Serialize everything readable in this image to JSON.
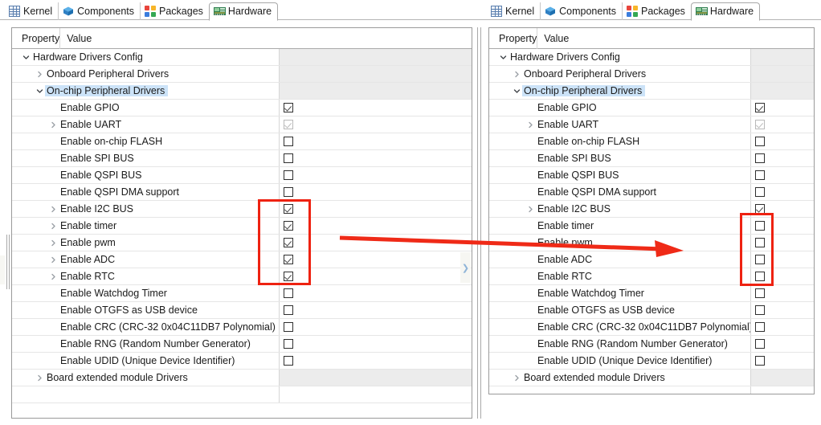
{
  "tabs": [
    {
      "id": "kernel",
      "label": "Kernel",
      "icon": "kernel-grid-icon",
      "active": false
    },
    {
      "id": "components",
      "label": "Components",
      "icon": "blue-cube-icon",
      "active": false
    },
    {
      "id": "packages",
      "label": "Packages",
      "icon": "packages-icon",
      "active": false
    },
    {
      "id": "hardware",
      "label": "Hardware",
      "icon": "board-chip-icon",
      "active": true
    }
  ],
  "columns": {
    "property": "Property",
    "value": "Value"
  },
  "colors": {
    "selection": "#cce3f8",
    "annotation": "#ee2211",
    "parent_row_value_bg": "#ececec",
    "grid_line": "#e6e6e6"
  },
  "before": {
    "rows": [
      {
        "label": "Hardware Drivers Config",
        "indent": 0,
        "twisty": "open",
        "value": "none",
        "selected": false
      },
      {
        "label": "Onboard Peripheral Drivers",
        "indent": 1,
        "twisty": "closed",
        "value": "none",
        "selected": false
      },
      {
        "label": "On-chip Peripheral Drivers",
        "indent": 1,
        "twisty": "open",
        "value": "none",
        "selected": true
      },
      {
        "label": "Enable GPIO",
        "indent": 2,
        "twisty": "none",
        "value": "checked",
        "selected": false
      },
      {
        "label": "Enable UART",
        "indent": 2,
        "twisty": "closed",
        "value": "checked-disabled",
        "selected": false
      },
      {
        "label": "Enable on-chip FLASH",
        "indent": 2,
        "twisty": "none",
        "value": "unchecked",
        "selected": false
      },
      {
        "label": "Enable SPI BUS",
        "indent": 2,
        "twisty": "none",
        "value": "unchecked",
        "selected": false
      },
      {
        "label": "Enable QSPI BUS",
        "indent": 2,
        "twisty": "none",
        "value": "unchecked",
        "selected": false
      },
      {
        "label": "Enable QSPI DMA support",
        "indent": 2,
        "twisty": "none",
        "value": "unchecked",
        "selected": false
      },
      {
        "label": "Enable I2C BUS",
        "indent": 2,
        "twisty": "closed",
        "value": "checked",
        "selected": false
      },
      {
        "label": "Enable timer",
        "indent": 2,
        "twisty": "closed",
        "value": "checked",
        "selected": false
      },
      {
        "label": "Enable pwm",
        "indent": 2,
        "twisty": "closed",
        "value": "checked",
        "selected": false
      },
      {
        "label": "Enable ADC",
        "indent": 2,
        "twisty": "closed",
        "value": "checked",
        "selected": false
      },
      {
        "label": "Enable RTC",
        "indent": 2,
        "twisty": "closed",
        "value": "checked",
        "selected": false
      },
      {
        "label": "Enable Watchdog Timer",
        "indent": 2,
        "twisty": "none",
        "value": "unchecked",
        "selected": false
      },
      {
        "label": "Enable OTGFS as USB device",
        "indent": 2,
        "twisty": "none",
        "value": "unchecked",
        "selected": false
      },
      {
        "label": "Enable CRC (CRC-32 0x04C11DB7 Polynomial)",
        "indent": 2,
        "twisty": "none",
        "value": "unchecked",
        "selected": false
      },
      {
        "label": "Enable RNG (Random Number Generator)",
        "indent": 2,
        "twisty": "none",
        "value": "unchecked",
        "selected": false
      },
      {
        "label": "Enable UDID (Unique Device Identifier)",
        "indent": 2,
        "twisty": "none",
        "value": "unchecked",
        "selected": false
      },
      {
        "label": "Board extended module Drivers",
        "indent": 1,
        "twisty": "closed",
        "value": "none",
        "selected": false
      },
      {
        "label": "",
        "indent": 0,
        "twisty": "none",
        "value": "blank",
        "selected": false
      }
    ]
  },
  "after": {
    "rows": [
      {
        "label": "Hardware Drivers Config",
        "indent": 0,
        "twisty": "open",
        "value": "none",
        "selected": false
      },
      {
        "label": "Onboard Peripheral Drivers",
        "indent": 1,
        "twisty": "closed",
        "value": "none",
        "selected": false
      },
      {
        "label": "On-chip Peripheral Drivers",
        "indent": 1,
        "twisty": "open",
        "value": "none",
        "selected": true
      },
      {
        "label": "Enable GPIO",
        "indent": 2,
        "twisty": "none",
        "value": "checked",
        "selected": false
      },
      {
        "label": "Enable UART",
        "indent": 2,
        "twisty": "closed",
        "value": "checked-disabled",
        "selected": false
      },
      {
        "label": "Enable on-chip FLASH",
        "indent": 2,
        "twisty": "none",
        "value": "unchecked",
        "selected": false
      },
      {
        "label": "Enable SPI BUS",
        "indent": 2,
        "twisty": "none",
        "value": "unchecked",
        "selected": false
      },
      {
        "label": "Enable QSPI BUS",
        "indent": 2,
        "twisty": "none",
        "value": "unchecked",
        "selected": false
      },
      {
        "label": "Enable QSPI DMA support",
        "indent": 2,
        "twisty": "none",
        "value": "unchecked",
        "selected": false
      },
      {
        "label": "Enable I2C BUS",
        "indent": 2,
        "twisty": "closed",
        "value": "checked",
        "selected": false
      },
      {
        "label": "Enable timer",
        "indent": 2,
        "twisty": "none",
        "value": "unchecked",
        "selected": false
      },
      {
        "label": "Enable pwm",
        "indent": 2,
        "twisty": "none",
        "value": "unchecked",
        "selected": false
      },
      {
        "label": "Enable ADC",
        "indent": 2,
        "twisty": "none",
        "value": "unchecked",
        "selected": false
      },
      {
        "label": "Enable RTC",
        "indent": 2,
        "twisty": "none",
        "value": "unchecked",
        "selected": false
      },
      {
        "label": "Enable Watchdog Timer",
        "indent": 2,
        "twisty": "none",
        "value": "unchecked",
        "selected": false
      },
      {
        "label": "Enable OTGFS as USB device",
        "indent": 2,
        "twisty": "none",
        "value": "unchecked",
        "selected": false
      },
      {
        "label": "Enable CRC (CRC-32 0x04C11DB7 Polynomial)",
        "indent": 2,
        "twisty": "none",
        "value": "unchecked",
        "selected": false
      },
      {
        "label": "Enable RNG (Random Number Generator)",
        "indent": 2,
        "twisty": "none",
        "value": "unchecked",
        "selected": false
      },
      {
        "label": "Enable UDID (Unique Device Identifier)",
        "indent": 2,
        "twisty": "none",
        "value": "unchecked",
        "selected": false
      },
      {
        "label": "Board extended module Drivers",
        "indent": 1,
        "twisty": "closed",
        "value": "none",
        "selected": false
      },
      {
        "label": "",
        "indent": 0,
        "twisty": "none",
        "value": "blank",
        "selected": false
      }
    ]
  },
  "annotations": {
    "left_highlight_rows": [
      "Enable I2C BUS",
      "Enable timer",
      "Enable pwm",
      "Enable ADC",
      "Enable RTC"
    ],
    "right_highlight_rows": [
      "Enable timer",
      "Enable pwm",
      "Enable ADC",
      "Enable RTC"
    ],
    "arrow": "red-right-arrow"
  },
  "splitter": {
    "handle_icon": "chevron-right-icon"
  }
}
